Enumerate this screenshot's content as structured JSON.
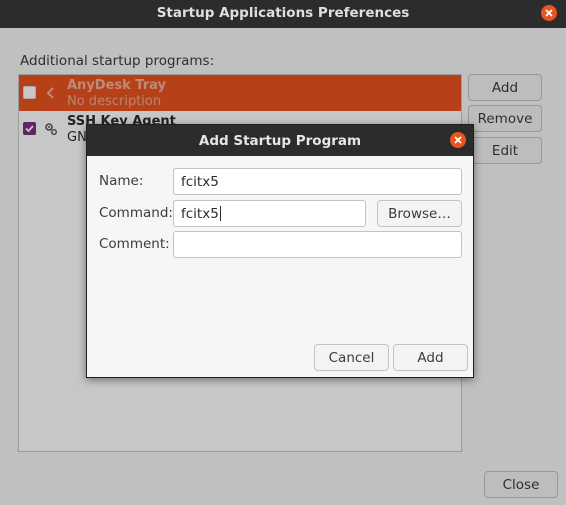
{
  "window": {
    "title": "Startup Applications Preferences"
  },
  "main": {
    "section_label": "Additional startup programs:",
    "programs": [
      {
        "name": "AnyDesk Tray",
        "description": "No description",
        "enabled": false,
        "selected": true,
        "icon": "chevron-left-icon"
      },
      {
        "name": "SSH Key Agent",
        "description": "GN",
        "enabled": true,
        "selected": false,
        "icon": "gears-icon"
      }
    ],
    "buttons": {
      "add": "Add",
      "remove": "Remove",
      "edit": "Edit",
      "close": "Close"
    }
  },
  "dialog": {
    "title": "Add Startup Program",
    "name_label": "Name:",
    "name_value": "fcitx5",
    "command_label": "Command:",
    "command_value": "fcitx5",
    "comment_label": "Comment:",
    "comment_value": "",
    "browse": "Browse…",
    "cancel": "Cancel",
    "add": "Add"
  },
  "colors": {
    "accent": "#e95420",
    "checkbox": "#7e2f7e",
    "titlebar": "#2c2c2c"
  }
}
